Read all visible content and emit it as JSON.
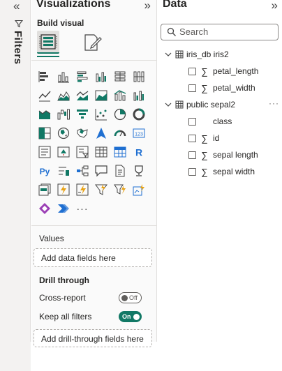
{
  "filters": {
    "label": "Filters",
    "collapse_icon": "double-chevron-left-icon",
    "filter_icon": "funnel-icon"
  },
  "visualizations": {
    "title": "Visualizations",
    "collapse_icon": "double-chevron-right-icon",
    "build_label": "Build visual",
    "build_icon": "build-visual-icon",
    "format_icon": "format-visual-icon",
    "accent_color": "#117865",
    "gallery": [
      "stacked-bar-chart-icon",
      "stacked-column-chart-icon",
      "clustered-bar-chart-icon",
      "clustered-column-chart-icon",
      "100-stacked-bar-chart-icon",
      "100-stacked-column-chart-icon",
      "line-chart-icon",
      "area-chart-icon",
      "stacked-area-chart-icon",
      "100-stacked-area-chart-icon",
      "line-and-stacked-column-chart-icon",
      "line-and-clustered-column-chart-icon",
      "ribbon-chart-icon",
      "waterfall-chart-icon",
      "funnel-chart-icon",
      "scatter-chart-icon",
      "pie-chart-icon",
      "donut-chart-icon",
      "treemap-icon",
      "map-icon",
      "filled-map-icon",
      "azure-map-icon",
      "gauge-icon",
      "card-icon",
      "multi-row-card-icon",
      "kpi-icon",
      "slicer-icon",
      "table-icon",
      "matrix-icon",
      "r-script-visual-icon",
      "python-visual-icon",
      "key-influencers-icon",
      "decomposition-tree-icon",
      "qa-icon",
      "smart-narrative-icon",
      "metrics-icon",
      "paginated-report-icon",
      "power-apps-icon",
      "power-automate-icon",
      "new-visual-icon",
      "filter-visual-icon",
      "azure-anomaly-icon",
      "custom-diamond-icon",
      "custom-chevron-icon",
      "more-visuals-icon"
    ],
    "more_label": "···",
    "values_label": "Values",
    "values_placeholder": "Add data fields here",
    "drill_label": "Drill through",
    "cross_report_label": "Cross-report",
    "cross_report_state": "Off",
    "keep_filters_label": "Keep all filters",
    "keep_filters_state": "On",
    "drill_placeholder": "Add drill-through fields here"
  },
  "data": {
    "title": "Data",
    "collapse_icon": "double-chevron-right-icon",
    "search_placeholder": "Search",
    "tables": [
      {
        "name": "iris_db iris2",
        "fields": [
          {
            "name": "petal_length",
            "sigma": true
          },
          {
            "name": "petal_width",
            "sigma": true
          }
        ]
      },
      {
        "name": "public sepal2",
        "more": "···",
        "fields": [
          {
            "name": "class",
            "sigma": false
          },
          {
            "name": "id",
            "sigma": true
          },
          {
            "name": "sepal length",
            "sigma": true
          },
          {
            "name": "sepal width",
            "sigma": true
          }
        ]
      }
    ],
    "sigma_symbol": "∑"
  }
}
